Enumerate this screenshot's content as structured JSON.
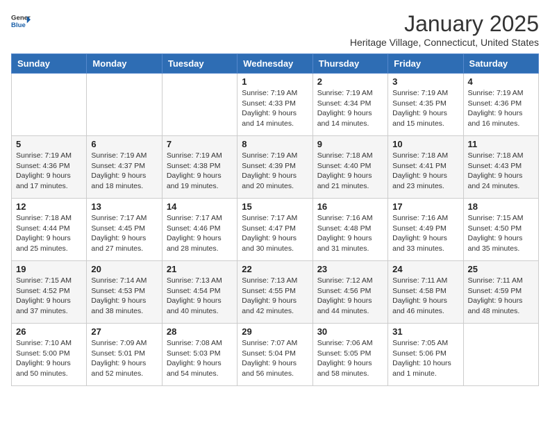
{
  "logo": {
    "general": "General",
    "blue": "Blue"
  },
  "header": {
    "month": "January 2025",
    "location": "Heritage Village, Connecticut, United States"
  },
  "weekdays": [
    "Sunday",
    "Monday",
    "Tuesday",
    "Wednesday",
    "Thursday",
    "Friday",
    "Saturday"
  ],
  "weeks": [
    [
      {
        "day": "",
        "info": ""
      },
      {
        "day": "",
        "info": ""
      },
      {
        "day": "",
        "info": ""
      },
      {
        "day": "1",
        "info": "Sunrise: 7:19 AM\nSunset: 4:33 PM\nDaylight: 9 hours\nand 14 minutes."
      },
      {
        "day": "2",
        "info": "Sunrise: 7:19 AM\nSunset: 4:34 PM\nDaylight: 9 hours\nand 14 minutes."
      },
      {
        "day": "3",
        "info": "Sunrise: 7:19 AM\nSunset: 4:35 PM\nDaylight: 9 hours\nand 15 minutes."
      },
      {
        "day": "4",
        "info": "Sunrise: 7:19 AM\nSunset: 4:36 PM\nDaylight: 9 hours\nand 16 minutes."
      }
    ],
    [
      {
        "day": "5",
        "info": "Sunrise: 7:19 AM\nSunset: 4:36 PM\nDaylight: 9 hours\nand 17 minutes."
      },
      {
        "day": "6",
        "info": "Sunrise: 7:19 AM\nSunset: 4:37 PM\nDaylight: 9 hours\nand 18 minutes."
      },
      {
        "day": "7",
        "info": "Sunrise: 7:19 AM\nSunset: 4:38 PM\nDaylight: 9 hours\nand 19 minutes."
      },
      {
        "day": "8",
        "info": "Sunrise: 7:19 AM\nSunset: 4:39 PM\nDaylight: 9 hours\nand 20 minutes."
      },
      {
        "day": "9",
        "info": "Sunrise: 7:18 AM\nSunset: 4:40 PM\nDaylight: 9 hours\nand 21 minutes."
      },
      {
        "day": "10",
        "info": "Sunrise: 7:18 AM\nSunset: 4:41 PM\nDaylight: 9 hours\nand 23 minutes."
      },
      {
        "day": "11",
        "info": "Sunrise: 7:18 AM\nSunset: 4:43 PM\nDaylight: 9 hours\nand 24 minutes."
      }
    ],
    [
      {
        "day": "12",
        "info": "Sunrise: 7:18 AM\nSunset: 4:44 PM\nDaylight: 9 hours\nand 25 minutes."
      },
      {
        "day": "13",
        "info": "Sunrise: 7:17 AM\nSunset: 4:45 PM\nDaylight: 9 hours\nand 27 minutes."
      },
      {
        "day": "14",
        "info": "Sunrise: 7:17 AM\nSunset: 4:46 PM\nDaylight: 9 hours\nand 28 minutes."
      },
      {
        "day": "15",
        "info": "Sunrise: 7:17 AM\nSunset: 4:47 PM\nDaylight: 9 hours\nand 30 minutes."
      },
      {
        "day": "16",
        "info": "Sunrise: 7:16 AM\nSunset: 4:48 PM\nDaylight: 9 hours\nand 31 minutes."
      },
      {
        "day": "17",
        "info": "Sunrise: 7:16 AM\nSunset: 4:49 PM\nDaylight: 9 hours\nand 33 minutes."
      },
      {
        "day": "18",
        "info": "Sunrise: 7:15 AM\nSunset: 4:50 PM\nDaylight: 9 hours\nand 35 minutes."
      }
    ],
    [
      {
        "day": "19",
        "info": "Sunrise: 7:15 AM\nSunset: 4:52 PM\nDaylight: 9 hours\nand 37 minutes."
      },
      {
        "day": "20",
        "info": "Sunrise: 7:14 AM\nSunset: 4:53 PM\nDaylight: 9 hours\nand 38 minutes."
      },
      {
        "day": "21",
        "info": "Sunrise: 7:13 AM\nSunset: 4:54 PM\nDaylight: 9 hours\nand 40 minutes."
      },
      {
        "day": "22",
        "info": "Sunrise: 7:13 AM\nSunset: 4:55 PM\nDaylight: 9 hours\nand 42 minutes."
      },
      {
        "day": "23",
        "info": "Sunrise: 7:12 AM\nSunset: 4:56 PM\nDaylight: 9 hours\nand 44 minutes."
      },
      {
        "day": "24",
        "info": "Sunrise: 7:11 AM\nSunset: 4:58 PM\nDaylight: 9 hours\nand 46 minutes."
      },
      {
        "day": "25",
        "info": "Sunrise: 7:11 AM\nSunset: 4:59 PM\nDaylight: 9 hours\nand 48 minutes."
      }
    ],
    [
      {
        "day": "26",
        "info": "Sunrise: 7:10 AM\nSunset: 5:00 PM\nDaylight: 9 hours\nand 50 minutes."
      },
      {
        "day": "27",
        "info": "Sunrise: 7:09 AM\nSunset: 5:01 PM\nDaylight: 9 hours\nand 52 minutes."
      },
      {
        "day": "28",
        "info": "Sunrise: 7:08 AM\nSunset: 5:03 PM\nDaylight: 9 hours\nand 54 minutes."
      },
      {
        "day": "29",
        "info": "Sunrise: 7:07 AM\nSunset: 5:04 PM\nDaylight: 9 hours\nand 56 minutes."
      },
      {
        "day": "30",
        "info": "Sunrise: 7:06 AM\nSunset: 5:05 PM\nDaylight: 9 hours\nand 58 minutes."
      },
      {
        "day": "31",
        "info": "Sunrise: 7:05 AM\nSunset: 5:06 PM\nDaylight: 10 hours\nand 1 minute."
      },
      {
        "day": "",
        "info": ""
      }
    ]
  ]
}
